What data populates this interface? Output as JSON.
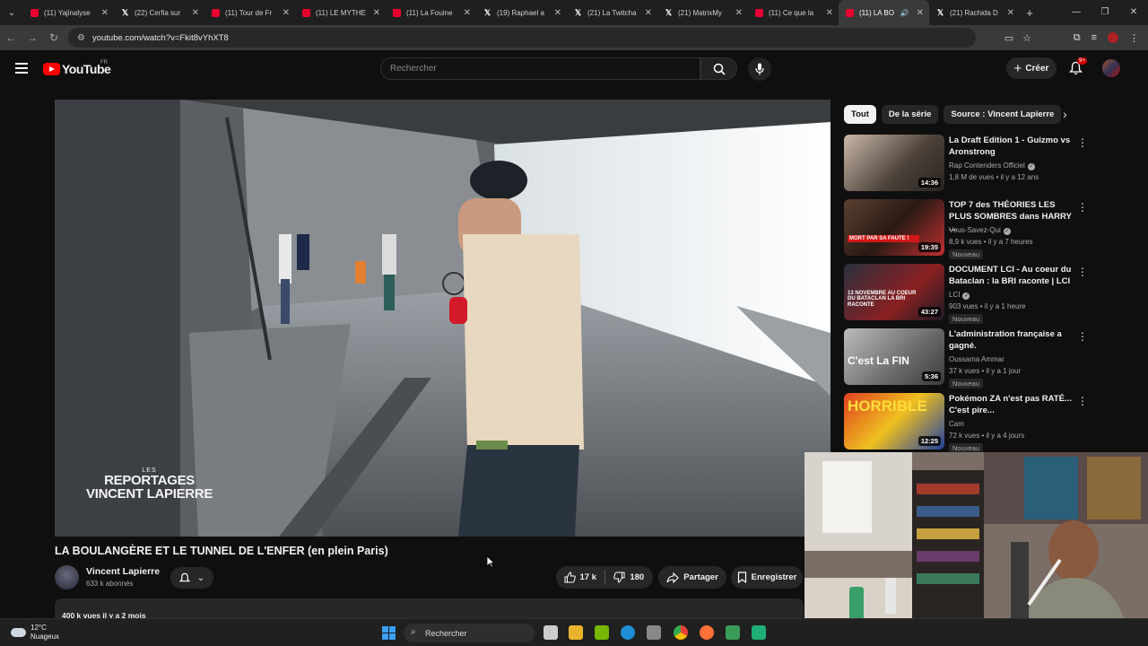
{
  "browser": {
    "tabs": [
      {
        "label": "(11) Yajinalyse",
        "icon": "youtube-icon"
      },
      {
        "label": "(22) Cerfia sur",
        "icon": "x-icon"
      },
      {
        "label": "(11) Tour de Fr",
        "icon": "youtube-icon"
      },
      {
        "label": "(11) LE MYTHE",
        "icon": "youtube-icon"
      },
      {
        "label": "(11) La Fouine",
        "icon": "youtube-icon"
      },
      {
        "label": "(19) Raphael a",
        "icon": "x-icon"
      },
      {
        "label": "(21) La Twitcha",
        "icon": "x-icon"
      },
      {
        "label": "(21) MatrixMy",
        "icon": "x-icon"
      },
      {
        "label": "(11) Ce que la",
        "icon": "youtube-icon"
      },
      {
        "label": "(11) LA BO",
        "icon": "youtube-icon",
        "active": true
      },
      {
        "label": "(21) Rachida D",
        "icon": "x-icon"
      }
    ],
    "url": "youtube.com/watch?v=Fkit8vYhXT8"
  },
  "youtube": {
    "logo_text": "YouTube",
    "country": "FR",
    "search_placeholder": "Rechercher",
    "create_label": "Créer",
    "notif_badge": "9+"
  },
  "video": {
    "title": "LA BOULANGÈRE ET LE TUNNEL DE L'ENFER (en plein Paris)",
    "watermark_small": "LES",
    "watermark_line1": "REPORTAGES",
    "watermark_line2": "VINCENT LAPIERRE",
    "channel": "Vincent Lapierre",
    "subscribers": "633 k abonnés",
    "likes": "17 k",
    "dislikes": "180",
    "share_label": "Partager",
    "save_label": "Enregistrer",
    "desc_meta": "400 k vues  il y a 2 mois"
  },
  "chips": [
    "Tout",
    "De la série",
    "Source : Vincent Lapierre"
  ],
  "recommendations": [
    {
      "title": "La Draft Edition 1 - Guizmo vs Aronstrong",
      "channel": "Rap Contenders Officiel",
      "verified": true,
      "meta": "1,8 M de vues • il y a 12 ans",
      "duration": "14:36",
      "new": ""
    },
    {
      "title": "TOP 7 des THÉORIES LES PLUS SOMBRES dans HARRY ...",
      "channel": "Vous-Savez-Qui",
      "verified": true,
      "meta": "8,9 k vues • il y a 7 heures",
      "duration": "19:35",
      "new": "Nouveau",
      "thumb_text": "MORT PAR SA FAUTE !"
    },
    {
      "title": "DOCUMENT LCI - Au coeur du Bataclan : la BRI raconte | LCI",
      "channel": "LCI",
      "verified": true,
      "meta": "903 vues • il y a 1 heure",
      "duration": "43:27",
      "new": "Nouveau",
      "thumb_text": "13 NOVEMBRE AU COEUR DU BATACLAN LA BRI RACONTE"
    },
    {
      "title": "L'administration française a gagné.",
      "channel": "Oussama Ammar",
      "verified": false,
      "meta": "37 k vues • il y a 1 jour",
      "duration": "5:36",
      "new": "Nouveau",
      "thumb_text": "C'est La FIN"
    },
    {
      "title": "Pokémon ZA n'est pas RATÉ... C'est pire...",
      "channel": "Cam",
      "verified": false,
      "meta": "72 k vues • il y a 4 jours",
      "duration": "12:25",
      "new": "Nouveau",
      "thumb_text": "HORRIBLE"
    }
  ],
  "taskbar": {
    "temp": "12°C",
    "weather": "Nuageux",
    "search": "Rechercher"
  }
}
